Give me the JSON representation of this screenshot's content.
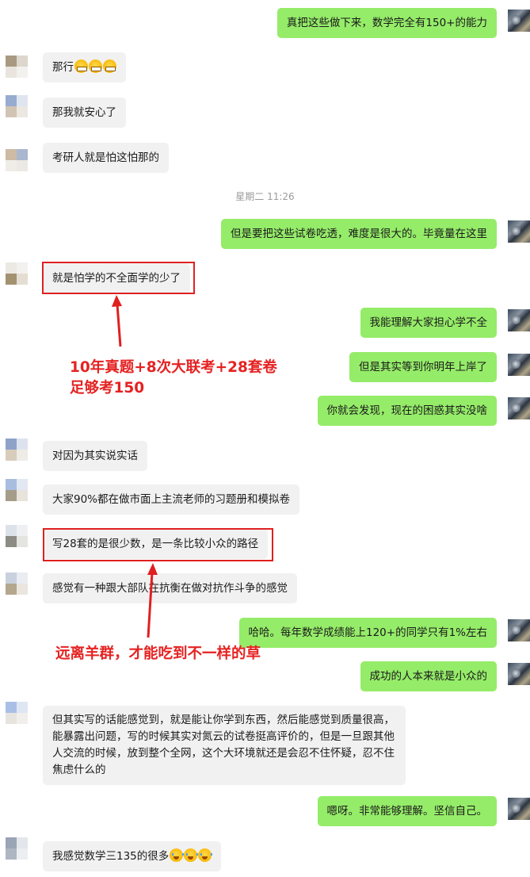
{
  "timestamp": "星期二 11:26",
  "messages": [
    {
      "id": "m1",
      "side": "out",
      "text": "真把这些做下来，数学完全有150+的能力"
    },
    {
      "id": "m2",
      "side": "in",
      "text": "那行",
      "emoji": [
        "grin",
        "grin",
        "grin"
      ]
    },
    {
      "id": "m3",
      "side": "in",
      "text": "那我就安心了"
    },
    {
      "id": "m4",
      "side": "in",
      "text": "考研人就是怕这怕那的"
    },
    {
      "id": "m5",
      "side": "out",
      "text": "但是要把这些试卷吃透，难度是很大的。毕竟量在这里"
    },
    {
      "id": "m6",
      "side": "in",
      "text": "就是怕学的不全面学的少了",
      "highlighted": true
    },
    {
      "id": "m7",
      "side": "out",
      "text": "我能理解大家担心学不全"
    },
    {
      "id": "m8",
      "side": "out",
      "text": "但是其实等到你明年上岸了"
    },
    {
      "id": "m9",
      "side": "out",
      "text": "你就会发现，现在的困惑其实没啥"
    },
    {
      "id": "m10",
      "side": "in",
      "text": "对因为其实说实话"
    },
    {
      "id": "m11",
      "side": "in",
      "text": "大家90%都在做市面上主流老师的习题册和模拟卷"
    },
    {
      "id": "m12",
      "side": "in",
      "text": "写28套的是很少数，是一条比较小众的路径",
      "highlighted": true
    },
    {
      "id": "m13",
      "side": "in",
      "text": "感觉有一种跟大部队在抗衡在做对抗作斗争的感觉"
    },
    {
      "id": "m14",
      "side": "out",
      "text": "哈哈。每年数学成绩能上120+的同学只有1%左右"
    },
    {
      "id": "m15",
      "side": "out",
      "text": "成功的人本来就是小众的"
    },
    {
      "id": "m16",
      "side": "in",
      "text": "但其实写的话能感觉到，就是能让你学到东西，然后能感觉到质量很高，能暴露出问题，写的时候其实对氮云的试卷挺高评价的，但是一旦跟其他人交流的时候，放到整个全网，这个大环境就还是会忍不住怀疑，忍不住焦虑什么的"
    },
    {
      "id": "m17",
      "side": "out",
      "text": "嗯呀。非常能够理解。坚信自己。"
    },
    {
      "id": "m18",
      "side": "in",
      "text": "我感觉数学三135的很多",
      "emoji": [
        "cry",
        "cry",
        "cry"
      ]
    }
  ],
  "annotations": {
    "note1_line1": "10年真题+8次大联考+28套卷",
    "note1_line2": "足够考150",
    "note2": "远离羊群，才能吃到不一样的草"
  },
  "colors": {
    "incoming_bubble": "#f1f1f2",
    "outgoing_bubble": "#95ec69",
    "annotation_red": "#e52222",
    "timestamp_gray": "#9a9a9a"
  }
}
